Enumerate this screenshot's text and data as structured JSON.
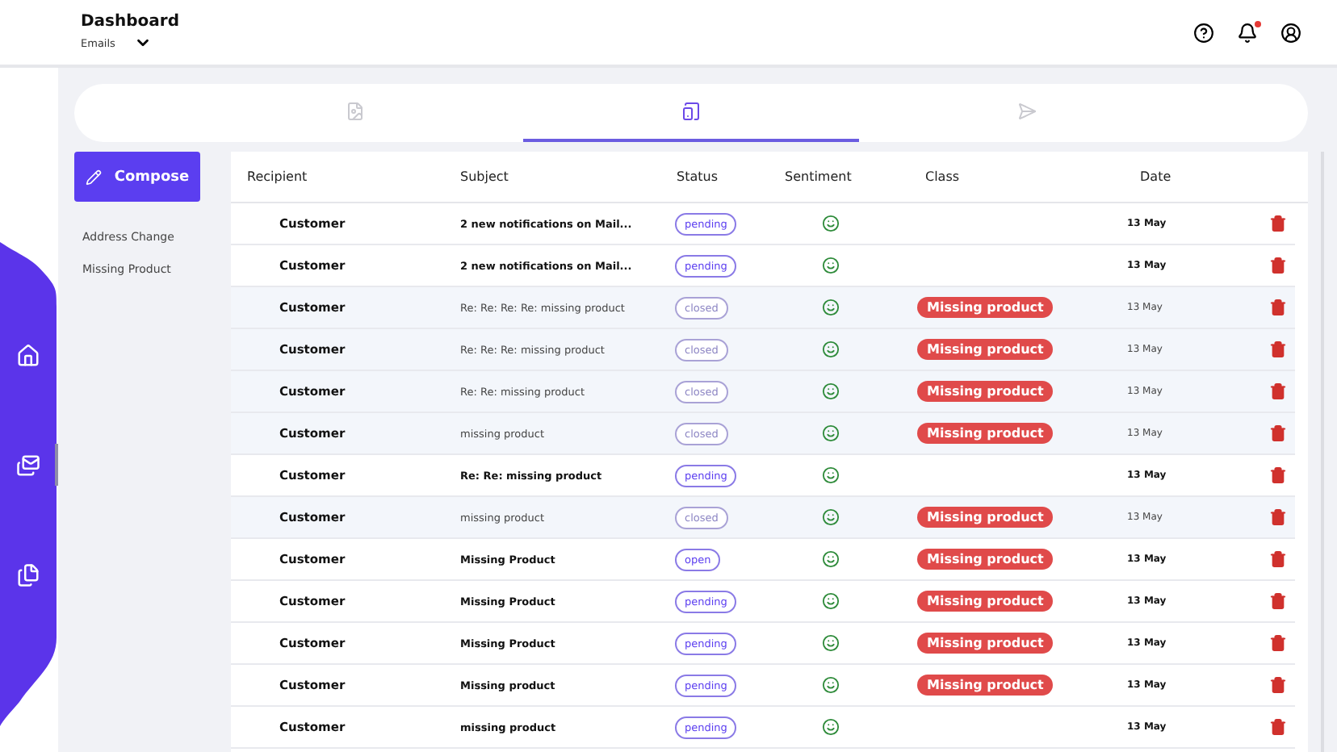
{
  "header": {
    "title": "Dashboard",
    "subtitle": "Emails",
    "notification_dot": true
  },
  "nav": [
    {
      "kind": "home",
      "selected": false
    },
    {
      "kind": "mail",
      "selected": true
    },
    {
      "kind": "file",
      "selected": false
    }
  ],
  "tabs": [
    {
      "kind": "document",
      "selected": false
    },
    {
      "kind": "tablet",
      "selected": true
    },
    {
      "kind": "send",
      "selected": false
    }
  ],
  "compose": {
    "label": "Compose"
  },
  "folders": [
    "Address Change",
    "Missing Product"
  ],
  "table": {
    "columns": [
      "Recipient",
      "Subject",
      "Status",
      "Sentiment",
      "Class",
      "Date"
    ],
    "rows": [
      {
        "recipient": "Customer",
        "subject": "2 new notifications on Mail...",
        "status": "pending",
        "class": "",
        "date": "13 May",
        "read": false
      },
      {
        "recipient": "Customer",
        "subject": "2 new notifications on Mail...",
        "status": "pending",
        "class": "",
        "date": "13 May",
        "read": false
      },
      {
        "recipient": "Customer",
        "subject": "Re: Re: Re: Re: missing product",
        "status": "closed",
        "class": "Missing product",
        "date": "13 May",
        "read": true
      },
      {
        "recipient": "Customer",
        "subject": "Re: Re: Re: missing product",
        "status": "closed",
        "class": "Missing product",
        "date": "13 May",
        "read": true
      },
      {
        "recipient": "Customer",
        "subject": "Re: Re: missing product",
        "status": "closed",
        "class": "Missing product",
        "date": "13 May",
        "read": true
      },
      {
        "recipient": "Customer",
        "subject": "missing product",
        "status": "closed",
        "class": "Missing product",
        "date": "13 May",
        "read": true
      },
      {
        "recipient": "Customer",
        "subject": "Re: Re: missing product",
        "status": "pending",
        "class": "",
        "date": "13 May",
        "read": false
      },
      {
        "recipient": "Customer",
        "subject": "missing product",
        "status": "closed",
        "class": "Missing product",
        "date": "13 May",
        "read": true
      },
      {
        "recipient": "Customer",
        "subject": "Missing Product",
        "status": "open",
        "class": "Missing product",
        "date": "13 May",
        "read": false
      },
      {
        "recipient": "Customer",
        "subject": "Missing Product",
        "status": "pending",
        "class": "Missing product",
        "date": "13 May",
        "read": false
      },
      {
        "recipient": "Customer",
        "subject": "Missing Product",
        "status": "pending",
        "class": "Missing product",
        "date": "13 May",
        "read": false
      },
      {
        "recipient": "Customer",
        "subject": "Missing product",
        "status": "pending",
        "class": "Missing product",
        "date": "13 May",
        "read": false
      },
      {
        "recipient": "Customer",
        "subject": "missing product",
        "status": "pending",
        "class": "",
        "date": "13 May",
        "read": false
      }
    ]
  }
}
